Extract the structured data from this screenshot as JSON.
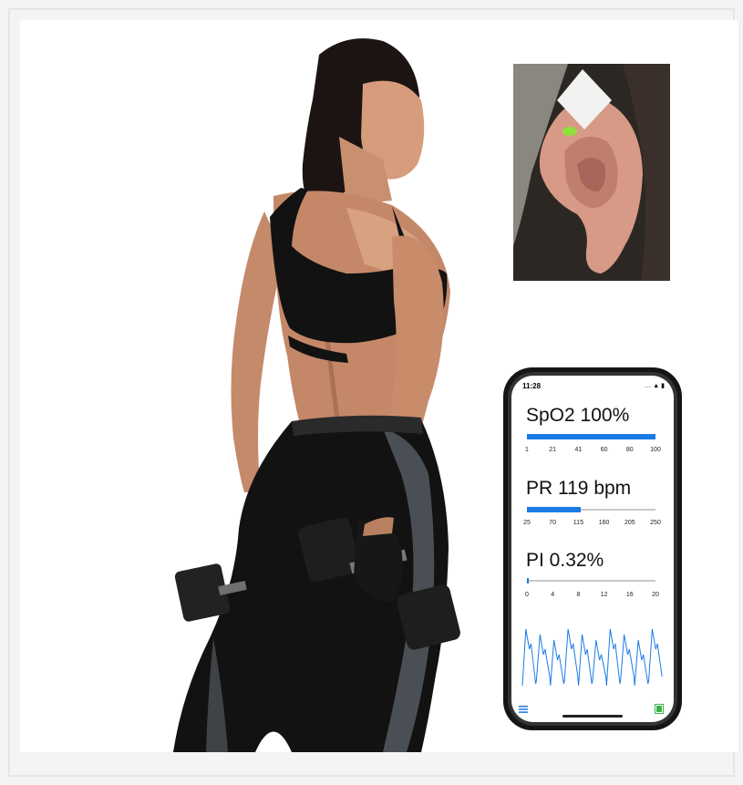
{
  "phone": {
    "status_time": "11:28",
    "status_icons": "… ▲ ▮",
    "spo2": {
      "label": "SpO2 100%",
      "value": 100,
      "min": 1,
      "max": 100,
      "ticks": [
        "1",
        "21",
        "41",
        "60",
        "80",
        "100"
      ]
    },
    "pr": {
      "label": "PR 119 bpm",
      "value": 119,
      "min": 25,
      "max": 250,
      "ticks": [
        "25",
        "70",
        "115",
        "160",
        "205",
        "250"
      ]
    },
    "pi": {
      "label": "PI 0.32%",
      "value": 0.32,
      "min": 0,
      "max": 20,
      "ticks": [
        "0",
        "4",
        "8",
        "12",
        "16",
        "20"
      ]
    },
    "accent_color": "#1a7be6",
    "battery_color": "#3bb34a",
    "icons": [
      "menu-icon",
      "battery-icon"
    ]
  },
  "photos": {
    "figure": "woman-with-dumbbells",
    "inset": "ear-with-sensor"
  }
}
